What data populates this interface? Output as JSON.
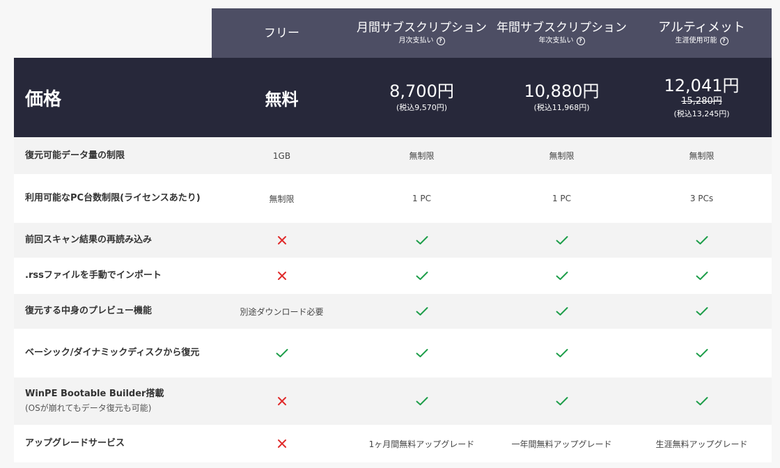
{
  "plans": [
    {
      "name": "フリー",
      "sub": ""
    },
    {
      "name": "月間サブスクリプション",
      "sub": "月次支払い"
    },
    {
      "name": "年間サブスクリプション",
      "sub": "年次支払い"
    },
    {
      "name": "アルティメット",
      "sub": "生涯使用可能"
    }
  ],
  "price": {
    "label": "価格",
    "free": "無料",
    "monthly": {
      "main": "8,700円",
      "tax": "(税込9,570円)"
    },
    "yearly": {
      "main": "10,880円",
      "tax": "(税込11,968円)"
    },
    "ultimate": {
      "main": "12,041円",
      "old": "15,280円",
      "tax": "(税込13,245円)"
    }
  },
  "features": [
    {
      "label": "復元可能データ量の制限",
      "note": "",
      "values": [
        "1GB",
        "無制限",
        "無制限",
        "無制限"
      ]
    },
    {
      "label": "利用可能なPC台数制限(ライセンスあたり)",
      "note": "",
      "values": [
        "無制限",
        "1 PC",
        "1 PC",
        "3 PCs"
      ]
    },
    {
      "label": "前回スキャン結果の再読み込み",
      "note": "",
      "values": [
        "cross",
        "check",
        "check",
        "check"
      ]
    },
    {
      "label": ".rssファイルを手動でインポート",
      "note": "",
      "values": [
        "cross",
        "check",
        "check",
        "check"
      ]
    },
    {
      "label": "復元する中身のプレビュー機能",
      "note": "",
      "values": [
        "別途ダウンロード必要",
        "check",
        "check",
        "check"
      ]
    },
    {
      "label": "ベーシック/ダイナミックディスクから復元",
      "note": "",
      "values": [
        "check",
        "check",
        "check",
        "check"
      ]
    },
    {
      "label": "WinPE Bootable Builder搭載",
      "note": "(OSが崩れてもデータ復元も可能)",
      "values": [
        "cross",
        "check",
        "check",
        "check"
      ]
    },
    {
      "label": "アップグレードサービス",
      "note": "",
      "values": [
        "cross",
        "1ヶ月間無料アップグレード",
        "一年間無料アップグレード",
        "生涯無料アップグレード"
      ]
    }
  ],
  "colors": {
    "check": "#1e9e4a",
    "cross": "#e02b2b",
    "header_bg": "#4d4e64",
    "price_bg": "#27283a"
  },
  "icons": {
    "check": "check-icon",
    "cross": "cross-icon",
    "help": "question-circle-icon"
  }
}
